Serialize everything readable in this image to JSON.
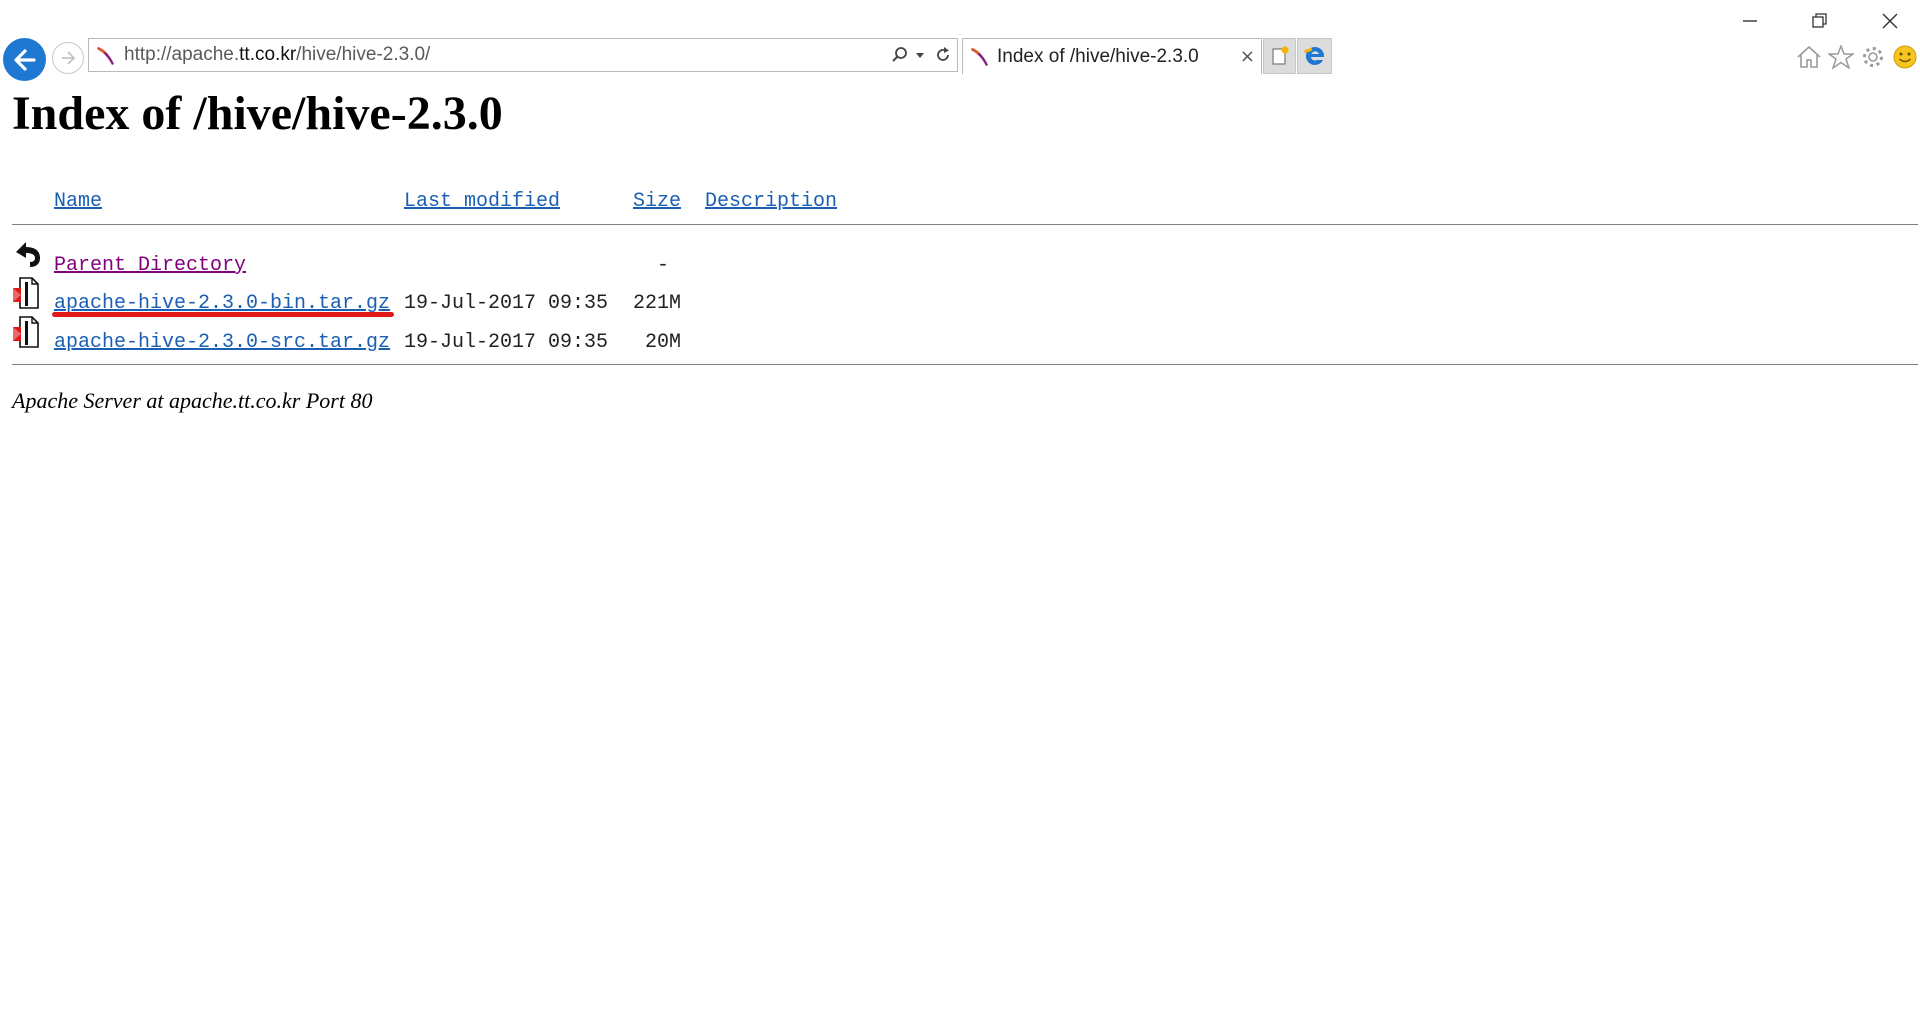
{
  "browser": {
    "url_prefix": "http://apache.",
    "url_host": "tt.co.kr",
    "url_path": "/hive/hive-2.3.0/",
    "tab_title": "Index of /hive/hive-2.3.0",
    "tab_close": "×",
    "accent_color": "#1e78d2"
  },
  "page": {
    "title": "Index of /hive/hive-2.3.0",
    "columns": {
      "name": "Name",
      "last_modified": "Last modified",
      "size": "Size",
      "description": "Description"
    },
    "rows": [
      {
        "icon": "back-arrow-icon",
        "name": "Parent Directory",
        "modified": "",
        "size": "-",
        "visited": true
      },
      {
        "icon": "archive-file-icon",
        "name": "apache-hive-2.3.0-bin.tar.gz",
        "modified": "19-Jul-2017 09:35",
        "size": "221M",
        "visited": false,
        "highlighted": true
      },
      {
        "icon": "archive-file-icon",
        "name": "apache-hive-2.3.0-src.tar.gz",
        "modified": "19-Jul-2017 09:35",
        "size": "20M",
        "visited": false
      }
    ],
    "footer": "Apache Server at apache.tt.co.kr Port 80",
    "link_color": "#1a5fb4",
    "visited_color": "#800080",
    "highlight_color": "#e01818"
  }
}
